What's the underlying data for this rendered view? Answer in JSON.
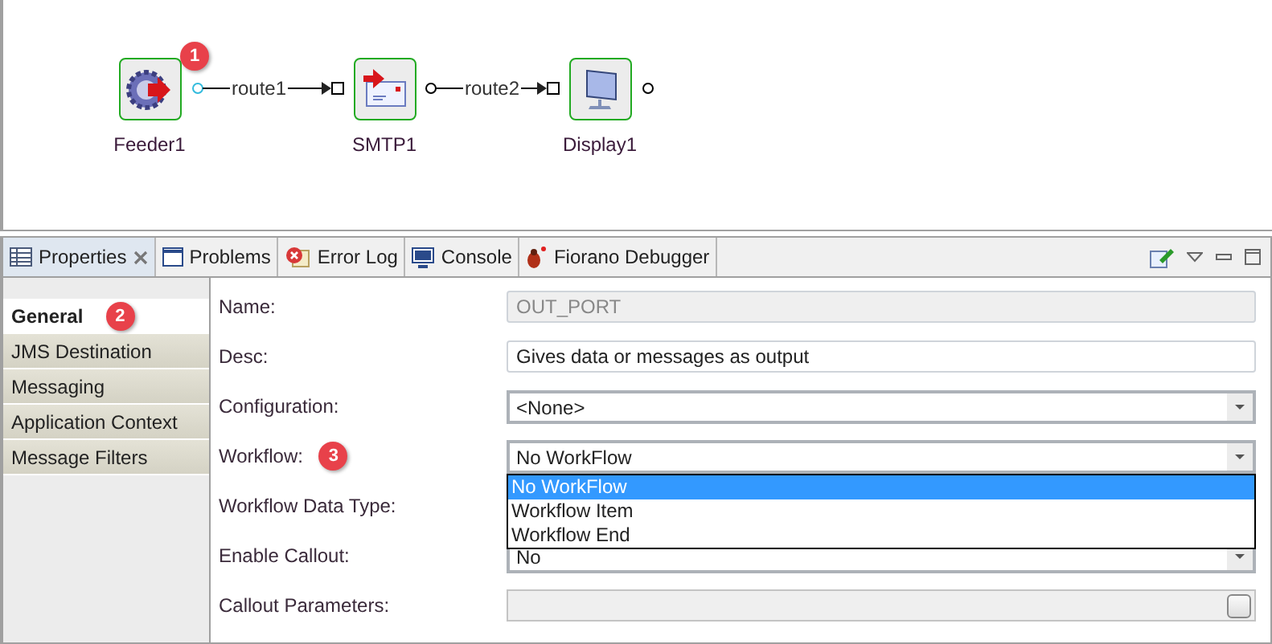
{
  "diagram": {
    "nodes": [
      {
        "label": "Feeder1",
        "kind": "feeder",
        "callout": "1"
      },
      {
        "label": "SMTP1",
        "kind": "mail"
      },
      {
        "label": "Display1",
        "kind": "display"
      }
    ],
    "routes": [
      {
        "label": "route1"
      },
      {
        "label": "route2"
      }
    ]
  },
  "tabs": [
    {
      "label": "Properties",
      "kind": "properties",
      "selected": true
    },
    {
      "label": "Problems",
      "kind": "problems",
      "selected": false
    },
    {
      "label": "Error Log",
      "kind": "errorlog",
      "selected": false
    },
    {
      "label": "Console",
      "kind": "console",
      "selected": false
    },
    {
      "label": "Fiorano Debugger",
      "kind": "debugger",
      "selected": false
    }
  ],
  "sections": [
    {
      "label": "General",
      "selected": true,
      "callout": "2"
    },
    {
      "label": "JMS Destination",
      "selected": false
    },
    {
      "label": "Messaging",
      "selected": false
    },
    {
      "label": "Application Context",
      "selected": false
    },
    {
      "label": "Message Filters",
      "selected": false
    }
  ],
  "form": {
    "rows": [
      {
        "label": "Name:",
        "kind": "text",
        "value": "OUT_PORT",
        "disabled": true
      },
      {
        "label": "Desc:",
        "kind": "text",
        "value": "Gives data or messages as output",
        "disabled": false
      },
      {
        "label": "Configuration:",
        "kind": "select",
        "value": "<None>"
      },
      {
        "label": "Workflow:",
        "kind": "select",
        "value": "No WorkFlow",
        "callout": "3",
        "open": true
      },
      {
        "label": "Workflow Data Type:",
        "kind": "covered"
      },
      {
        "label": "Enable Callout:",
        "kind": "select",
        "value": "No"
      },
      {
        "label": "Callout Parameters:",
        "kind": "browse",
        "disabled": true
      }
    ]
  },
  "dropdown": {
    "options": [
      {
        "label": "No WorkFlow",
        "selected": true
      },
      {
        "label": "Workflow Item",
        "selected": false
      },
      {
        "label": "Workflow End",
        "selected": false
      }
    ]
  }
}
